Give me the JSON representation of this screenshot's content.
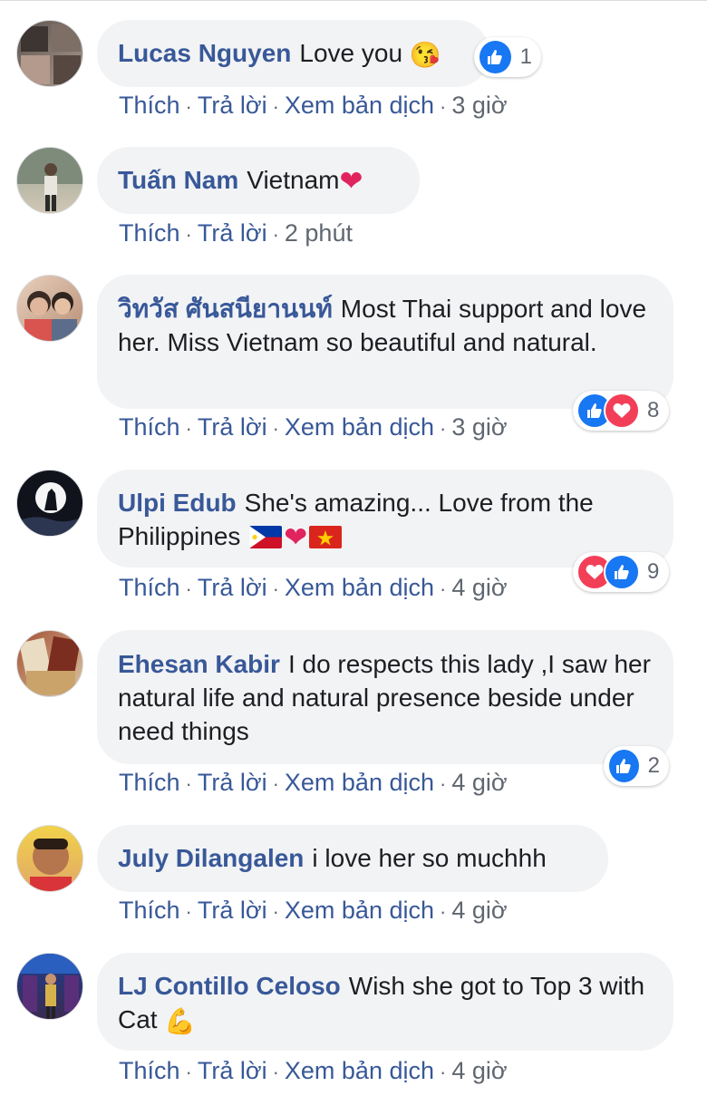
{
  "actions": {
    "like": "Thích",
    "reply": "Trả lời",
    "translate": "Xem bản dịch",
    "separator": "·"
  },
  "comments": [
    {
      "author": "Lucas Nguyen",
      "text": "Love you",
      "emoji": "😘",
      "reactions": {
        "types": [
          "like-icon"
        ],
        "count": "1"
      },
      "time": "3 giờ",
      "has_translate": true,
      "avatar_colors": [
        "#6b5f5a",
        "#9a8f86"
      ]
    },
    {
      "author": "Tuấn Nam",
      "text": "Vietnam",
      "emoji": "❤",
      "reactions": null,
      "time": "2 phút",
      "has_translate": false,
      "avatar_colors": [
        "#8a9a8a",
        "#c2b8a8"
      ]
    },
    {
      "author": "วิทวัส ศันสนียานนท์",
      "text": "Most Thai support and love her. Miss Vietnam so beautiful and natural.",
      "reactions": {
        "types": [
          "like-icon",
          "love-icon"
        ],
        "count": "8"
      },
      "time": "3 giờ",
      "has_translate": true,
      "avatar_colors": [
        "#d9b59a",
        "#7a5a48"
      ]
    },
    {
      "author": "Ulpi Edub",
      "text": "She's amazing... Love from the Philippines",
      "reactions": {
        "types": [
          "love-icon",
          "like-icon"
        ],
        "count": "9"
      },
      "time": "4 giờ",
      "has_translate": true,
      "avatar_colors": [
        "#10131c",
        "#2a3347"
      ]
    },
    {
      "author": "Ehesan Kabir",
      "text": "I do respects this lady ,I saw her natural life and natural presence beside under need things",
      "reactions": {
        "types": [
          "like-icon"
        ],
        "count": "2"
      },
      "time": "4 giờ",
      "has_translate": true,
      "avatar_colors": [
        "#8f4a32",
        "#d8c2a0"
      ]
    },
    {
      "author": "July Dilangalen",
      "text": "i love her so muchhh",
      "reactions": null,
      "time": "4 giờ",
      "has_translate": true,
      "avatar_colors": [
        "#f0c33a",
        "#c98a5e"
      ]
    },
    {
      "author": "LJ Contillo Celoso",
      "text": "Wish she got to Top 3 with Cat",
      "emoji": "💪",
      "reactions": null,
      "time": "4 giờ",
      "has_translate": true,
      "avatar_colors": [
        "#1b3f8a",
        "#3a2a4e"
      ]
    }
  ],
  "colors": {
    "author": "#385898",
    "bubble": "#f2f3f5",
    "meta": "#606770",
    "like": "#1877f2",
    "love": "#f33e58"
  }
}
